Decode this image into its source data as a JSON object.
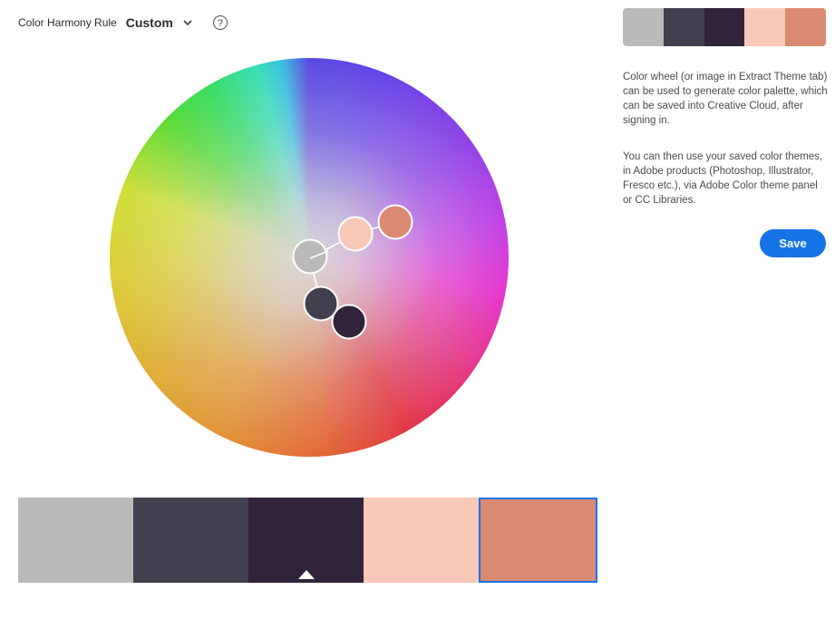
{
  "header": {
    "rule_label": "Color Harmony Rule",
    "rule_value": "Custom",
    "help_symbol": "?"
  },
  "palette": [
    "#bbbab9",
    "#433f4f",
    "#31233a",
    "#f8c9b9",
    "#da8a73"
  ],
  "selected_swatch": 4,
  "side": {
    "description_1": "Color wheel (or image in Extract Theme tab) can be used to generate color palette, which can be saved into Creative Cloud, after signing in.",
    "description_2": "You can then use your saved color themes, in Adobe products (Photoshop, Illustrator, Fresco etc.), via Adobe Color theme panel or CC Libraries.",
    "save_label": "Save"
  },
  "icons": {
    "dropdown": "chevron-down-icon",
    "help": "help-icon",
    "caret": "caret-up-icon"
  }
}
